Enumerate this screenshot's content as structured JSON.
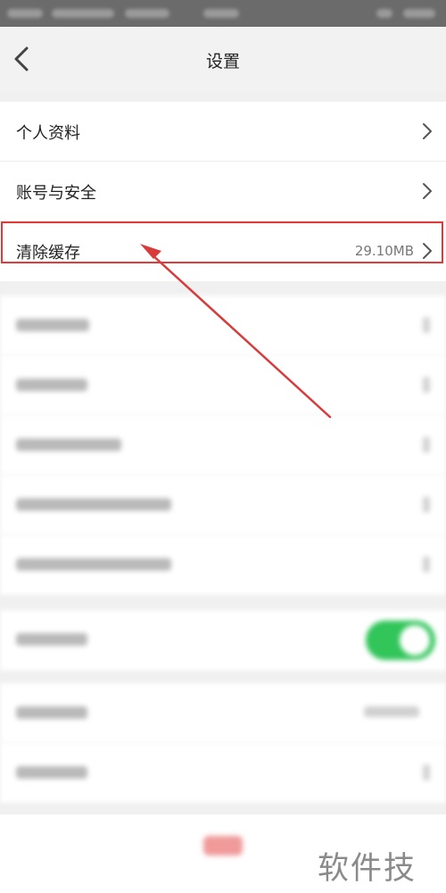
{
  "header": {
    "title": "设置"
  },
  "group1": {
    "items": [
      {
        "label": "个人资料"
      },
      {
        "label": "账号与安全"
      },
      {
        "label": "清除缓存",
        "value": "29.10MB"
      }
    ]
  },
  "colors": {
    "toggle_on": "#31c55a",
    "highlight": "#e03a3a",
    "arrow": "#d93b3b"
  },
  "annotations": {
    "watermark": "软件技巧"
  }
}
